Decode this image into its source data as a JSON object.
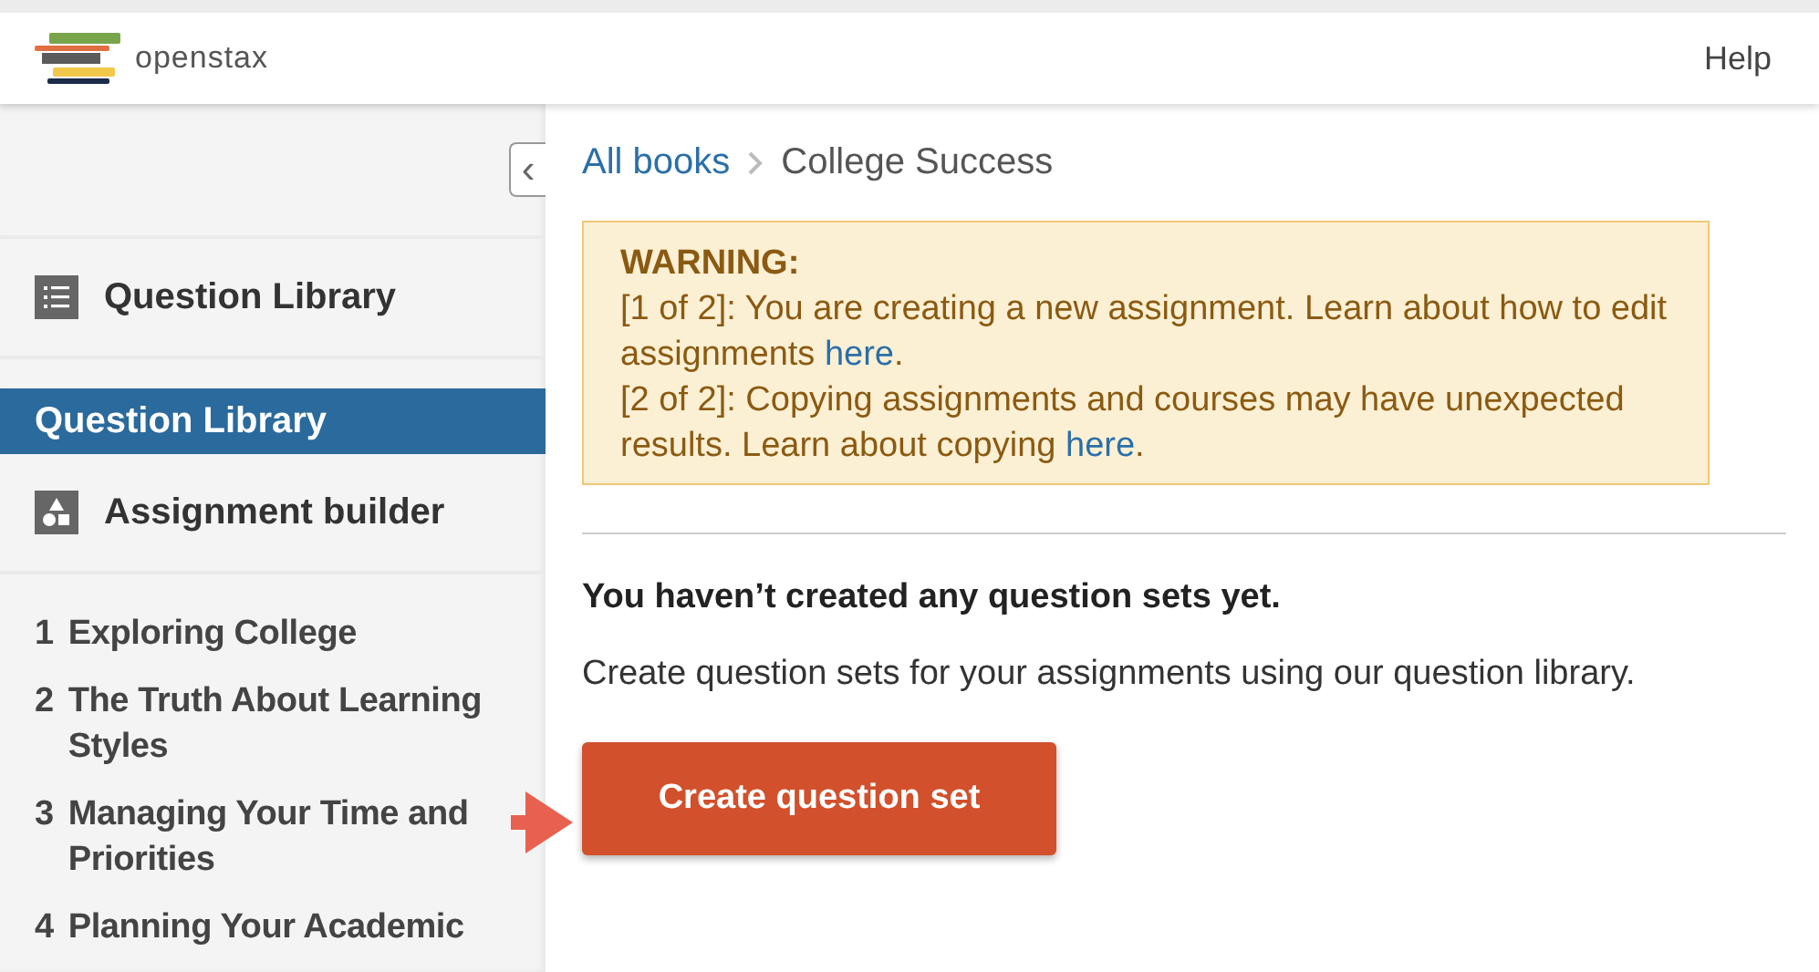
{
  "header": {
    "logo_text": "openstax",
    "help": "Help"
  },
  "sidebar": {
    "collapse_icon": "‹",
    "sections": [
      {
        "label": "Question Library",
        "selected": false,
        "kind": "list"
      },
      {
        "label": "Question Library",
        "selected": true,
        "kind": "plain"
      },
      {
        "label": "Assignment builder",
        "selected": false,
        "kind": "builder"
      }
    ],
    "chapters": [
      {
        "number": "1",
        "title": "Exploring College"
      },
      {
        "number": "2",
        "title": "The Truth About Learning Styles"
      },
      {
        "number": "3",
        "title": "Managing Your Time and Priorities"
      },
      {
        "number": "4",
        "title": "Planning Your Academic"
      }
    ]
  },
  "breadcrumb": [
    {
      "label": "All books",
      "kind": "link"
    },
    {
      "label": "College Success",
      "kind": "current"
    }
  ],
  "warning": {
    "title": "WARNING:",
    "lines": [
      {
        "before": "[1 of 2]: You are creating a new assignment. Learn about how to edit assignments ",
        "link": "here",
        "after": "."
      },
      {
        "before": "[2 of 2]: Copying assignments and courses may have unexpected results. Learn about copying ",
        "link": "here",
        "after": "."
      }
    ]
  },
  "empty_state": {
    "heading": "You haven’t created any question sets yet.",
    "text": "Create question sets for your assignments using our question library.",
    "button": "Create question set"
  }
}
